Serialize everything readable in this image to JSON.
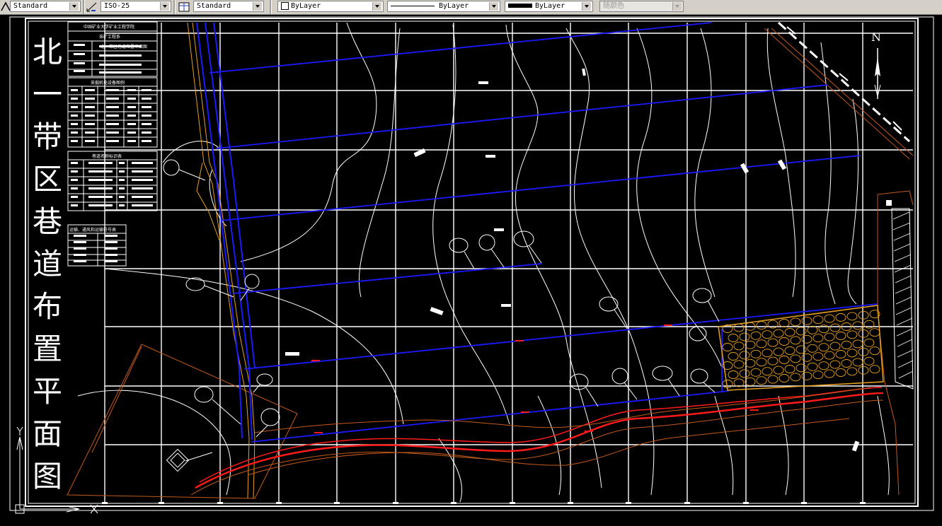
{
  "toolbar": {
    "text_style": "Standard",
    "dim_style": "ISO-25",
    "table_style": "Standard",
    "layer_color": "ByLayer",
    "linetype": "ByLayer",
    "lineweight": "ByLayer",
    "plot_style": "随颜色"
  },
  "drawing": {
    "title_chars": [
      "北",
      "一",
      "带",
      "区",
      "巷",
      "道",
      "布",
      "置",
      "平",
      "面",
      "图"
    ],
    "north_label": "N",
    "title_block": {
      "school": "中国矿业大学矿业工程学院",
      "course": "采矿工程系",
      "subtitle": "北一带区巷道布置平面图"
    },
    "legends": {
      "equipment": "采掘机电设备图例",
      "roadway_names": "巷道名称标识表",
      "transport": "运输、通风和运输符号表"
    }
  },
  "colors": {
    "background": "#000000",
    "grid": "#ffffff",
    "roadway": "#1a1aff",
    "haulage": "#ff1a1a",
    "boundary": "#c45a1a",
    "fault": "#e8a020",
    "goaf": "#e8a020"
  }
}
